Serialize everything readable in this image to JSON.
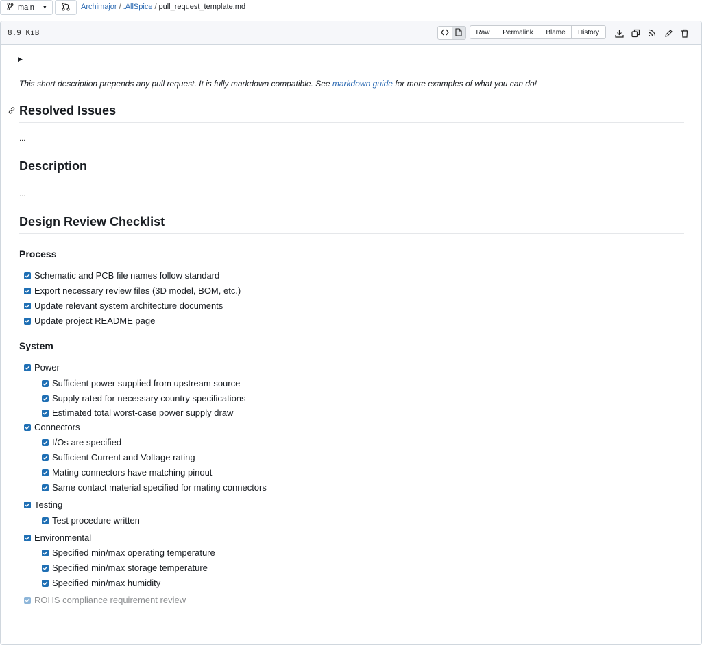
{
  "topbar": {
    "branch": "main",
    "breadcrumb": {
      "owner": "Archimajor",
      "repo": ".AllSpice",
      "file": "pull_request_template.md",
      "sep": "/"
    }
  },
  "file_header": {
    "size": "8.9 KiB",
    "buttons": {
      "raw": "Raw",
      "permalink": "Permalink",
      "blame": "Blame",
      "history": "History"
    }
  },
  "markdown": {
    "intro_before": "This short description prepends any pull request. It is fully markdown compatible. See ",
    "intro_link": "markdown guide",
    "intro_after": " for more examples of what you can do!",
    "resolved_issues": "Resolved Issues",
    "resolved_ellipsis": "...",
    "description": "Description",
    "description_ellipsis": "...",
    "checklist_title": "Design Review Checklist",
    "process_title": "Process",
    "process_items": [
      "Schematic and PCB file names follow standard",
      "Export necessary review files (3D model, BOM, etc.)",
      "Update relevant system architecture documents",
      "Update project README page"
    ],
    "system_title": "System",
    "power": "Power",
    "power_items": [
      "Sufficient power supplied from upstream source",
      "Supply rated for necessary country specifications",
      "Estimated total worst-case power supply draw"
    ],
    "connectors": "Connectors",
    "connector_items": [
      "I/Os are specified",
      "Sufficient Current and Voltage rating",
      "Mating connectors have matching pinout",
      "Same contact material specified for mating connectors"
    ],
    "testing": "Testing",
    "testing_items": [
      "Test procedure written"
    ],
    "environmental": "Environmental",
    "environmental_items": [
      "Specified min/max operating temperature",
      "Specified min/max storage temperature",
      "Specified min/max humidity"
    ],
    "rohs": "ROHS compliance requirement review"
  },
  "colors": {
    "link": "#2d6bb3",
    "checkbox": "#1f6fb4"
  }
}
